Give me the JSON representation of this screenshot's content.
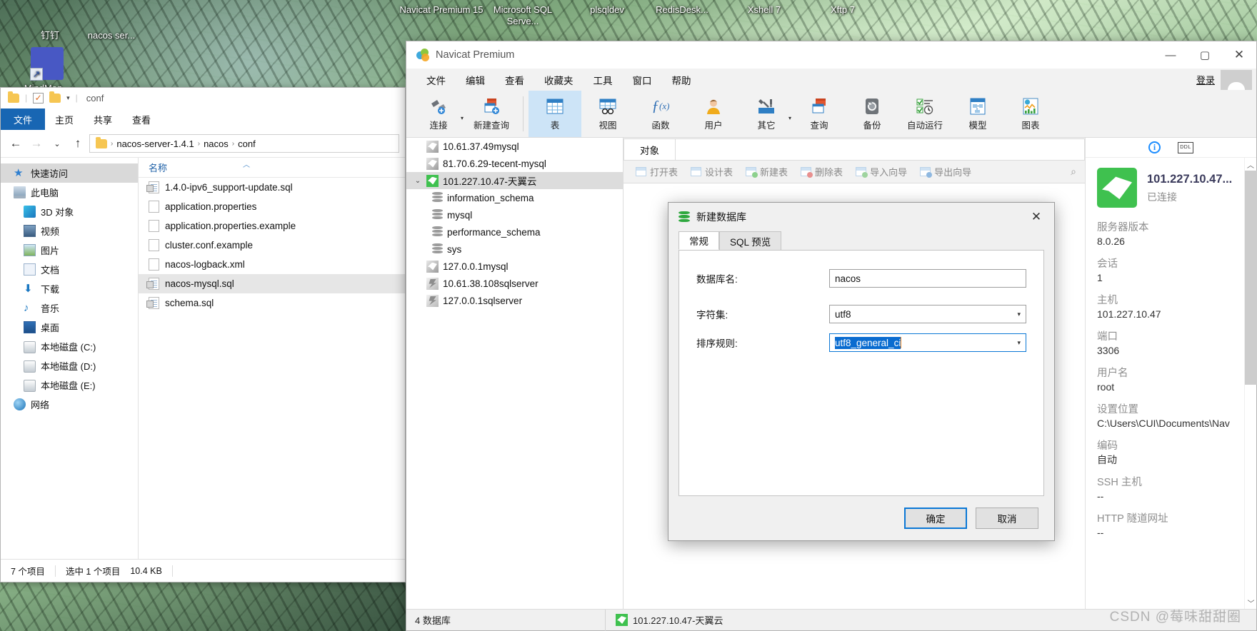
{
  "desktop": {
    "icons": [
      {
        "name": "钉钉",
        "icon": "dingtalk-icon"
      },
      {
        "name": "nacos ser...",
        "icon": "folder-icon"
      },
      {
        "name": "MindMan...",
        "icon": "mindmanager-icon"
      }
    ],
    "taskbar_labels": [
      "Navicat Premium 15",
      "Microsoft SQL Serve...",
      "plsqldev",
      "RedisDesk...",
      "Xshell 7",
      "Xftp 7"
    ]
  },
  "explorer": {
    "quick_access_title": "conf",
    "ribbon_tabs": [
      "文件",
      "主页",
      "共享",
      "查看"
    ],
    "breadcrumb": [
      "nacos-server-1.4.1",
      "nacos",
      "conf"
    ],
    "nav": {
      "quick_access": "快速访问",
      "this_pc": "此电脑",
      "items": [
        {
          "label": "3D 对象",
          "icon": "3d-objects-icon"
        },
        {
          "label": "视频",
          "icon": "videos-icon"
        },
        {
          "label": "图片",
          "icon": "pictures-icon"
        },
        {
          "label": "文档",
          "icon": "documents-icon"
        },
        {
          "label": "下载",
          "icon": "downloads-icon"
        },
        {
          "label": "音乐",
          "icon": "music-icon"
        },
        {
          "label": "桌面",
          "icon": "desktop-icon"
        },
        {
          "label": "本地磁盘 (C:)",
          "icon": "drive-c-icon"
        },
        {
          "label": "本地磁盘 (D:)",
          "icon": "drive-d-icon"
        },
        {
          "label": "本地磁盘 (E:)",
          "icon": "drive-e-icon"
        }
      ],
      "network": "网络"
    },
    "column_header": "名称",
    "files": [
      {
        "name": "1.4.0-ipv6_support-update.sql",
        "type": "sql",
        "selected": false
      },
      {
        "name": "application.properties",
        "type": "file",
        "selected": false
      },
      {
        "name": "application.properties.example",
        "type": "file",
        "selected": false
      },
      {
        "name": "cluster.conf.example",
        "type": "file",
        "selected": false
      },
      {
        "name": "nacos-logback.xml",
        "type": "file",
        "selected": false
      },
      {
        "name": "nacos-mysql.sql",
        "type": "sql",
        "selected": true
      },
      {
        "name": "schema.sql",
        "type": "sql",
        "selected": false
      }
    ],
    "status": {
      "count": "7 个项目",
      "selection": "选中 1 个项目",
      "size": "10.4 KB"
    }
  },
  "navicat": {
    "window_title": "Navicat Premium",
    "login_label": "登录",
    "menus": [
      "文件",
      "编辑",
      "查看",
      "收藏夹",
      "工具",
      "窗口",
      "帮助"
    ],
    "toolbar": [
      {
        "label": "连接",
        "icon": "new-connection-icon",
        "active": false,
        "caret": true
      },
      {
        "label": "新建查询",
        "icon": "new-query-icon",
        "active": false,
        "caret": false
      },
      {
        "label": "表",
        "icon": "table-icon",
        "active": true,
        "caret": false
      },
      {
        "label": "视图",
        "icon": "view-icon",
        "active": false,
        "caret": false
      },
      {
        "label": "函数",
        "icon": "function-icon",
        "active": false,
        "caret": false
      },
      {
        "label": "用户",
        "icon": "user-icon",
        "active": false,
        "caret": false
      },
      {
        "label": "其它",
        "icon": "other-tools-icon",
        "active": false,
        "caret": true
      },
      {
        "label": "查询",
        "icon": "query-icon",
        "active": false,
        "caret": false
      },
      {
        "label": "备份",
        "icon": "backup-icon",
        "active": false,
        "caret": false
      },
      {
        "label": "自动运行",
        "icon": "automation-icon",
        "active": false,
        "caret": false
      },
      {
        "label": "模型",
        "icon": "model-icon",
        "active": false,
        "caret": false
      },
      {
        "label": "图表",
        "icon": "chart-icon",
        "active": false,
        "caret": false
      }
    ],
    "tree": [
      {
        "label": "10.61.37.49mysql",
        "icon": "mysql-connection-icon",
        "indent": 0,
        "selected": false,
        "expanded": null,
        "connected": false
      },
      {
        "label": "81.70.6.29-tecent-mysql",
        "icon": "mysql-connection-icon",
        "indent": 0,
        "selected": false,
        "expanded": null,
        "connected": false
      },
      {
        "label": "101.227.10.47-天翼云",
        "icon": "mysql-connection-icon",
        "indent": 0,
        "selected": true,
        "expanded": true,
        "connected": true
      },
      {
        "label": "information_schema",
        "icon": "database-icon",
        "indent": 1,
        "selected": false,
        "expanded": null,
        "connected": false
      },
      {
        "label": "mysql",
        "icon": "database-icon",
        "indent": 1,
        "selected": false,
        "expanded": null,
        "connected": false
      },
      {
        "label": "performance_schema",
        "icon": "database-icon",
        "indent": 1,
        "selected": false,
        "expanded": null,
        "connected": false
      },
      {
        "label": "sys",
        "icon": "database-icon",
        "indent": 1,
        "selected": false,
        "expanded": null,
        "connected": false
      },
      {
        "label": "127.0.0.1mysql",
        "icon": "mysql-connection-icon",
        "indent": 0,
        "selected": false,
        "expanded": null,
        "connected": false
      },
      {
        "label": "10.61.38.108sqlserver",
        "icon": "sqlserver-connection-icon",
        "indent": 0,
        "selected": false,
        "expanded": null,
        "connected": false
      },
      {
        "label": "127.0.0.1sqlserver",
        "icon": "sqlserver-connection-icon",
        "indent": 0,
        "selected": false,
        "expanded": null,
        "connected": false
      }
    ],
    "object_tab": "对象",
    "object_actions": [
      {
        "label": "打开表",
        "icon": "open-table-icon"
      },
      {
        "label": "设计表",
        "icon": "design-table-icon"
      },
      {
        "label": "新建表",
        "icon": "new-table-icon"
      },
      {
        "label": "删除表",
        "icon": "delete-table-icon"
      },
      {
        "label": "导入向导",
        "icon": "import-wizard-icon"
      },
      {
        "label": "导出向导",
        "icon": "export-wizard-icon"
      }
    ],
    "status": {
      "db_count": "4 数据库",
      "connection": "101.227.10.47-天翼云"
    },
    "info": {
      "connection_name": "101.227.10.47...",
      "connection_state": "已连接",
      "rows": [
        {
          "label": "服务器版本",
          "value": "8.0.26"
        },
        {
          "label": "会话",
          "value": "1"
        },
        {
          "label": "主机",
          "value": "101.227.10.47"
        },
        {
          "label": "端口",
          "value": "3306"
        },
        {
          "label": "用户名",
          "value": "root"
        },
        {
          "label": "设置位置",
          "value": "C:\\Users\\CUI\\Documents\\Nav"
        },
        {
          "label": "编码",
          "value": "自动"
        },
        {
          "label": "SSH 主机",
          "value": "--"
        },
        {
          "label": "HTTP 隧道网址",
          "value": "--"
        }
      ]
    }
  },
  "dialog": {
    "title": "新建数据库",
    "tabs": [
      {
        "label": "常规",
        "active": true
      },
      {
        "label": "SQL 预览",
        "active": false
      }
    ],
    "fields": [
      {
        "label": "数据库名:",
        "value": "nacos",
        "type": "text",
        "focused": false
      },
      {
        "label": "字符集:",
        "value": "utf8",
        "type": "select",
        "focused": false
      },
      {
        "label": "排序规则:",
        "value": "utf8_general_ci",
        "type": "select",
        "focused": true,
        "selected": true
      }
    ],
    "ok_label": "确定",
    "cancel_label": "取消"
  },
  "watermark": "CSDN @莓味甜甜圈",
  "colors": {
    "accent_blue": "#0a77d5",
    "explorer_file_tab": "#1866b3",
    "navicat_active_tool": "#cde4f7",
    "connected_green": "#3fc14f",
    "selection_blue": "#0a6cd0"
  }
}
